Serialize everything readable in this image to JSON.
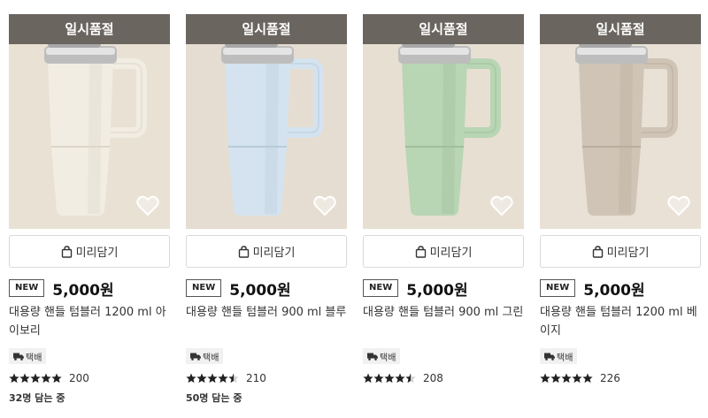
{
  "products": [
    {
      "soldout_label": "일시품절",
      "cart_label": "미리담기",
      "badge": "NEW",
      "price": "5,000원",
      "name": "대용량 핸들 텀블러 1200 ml 아이보리",
      "shipping": "택배",
      "rating": 5,
      "review_count": "200",
      "in_cart": "32명 담는 중",
      "bg_color": "#e9e1d4",
      "body_color": "#f1ede2",
      "shade_color": "#dcd6c9"
    },
    {
      "soldout_label": "일시품절",
      "cart_label": "미리담기",
      "badge": "NEW",
      "price": "5,000원",
      "name": "대용량 핸들 텀블러 900 ml 블루",
      "shipping": "택배",
      "rating": 4.5,
      "review_count": "210",
      "in_cart": "50명 담는 중",
      "bg_color": "#e5ddd1",
      "body_color": "#d4e3ef",
      "shade_color": "#b9cbd9"
    },
    {
      "soldout_label": "일시품절",
      "cart_label": "미리담기",
      "badge": "NEW",
      "price": "5,000원",
      "name": "대용량 핸들 텀블러 900 ml 그린",
      "shipping": "택배",
      "rating": 4.5,
      "review_count": "208",
      "in_cart": "",
      "bg_color": "#e7dfd2",
      "body_color": "#b8d5b4",
      "shade_color": "#9fbf9b"
    },
    {
      "soldout_label": "일시품절",
      "cart_label": "미리담기",
      "badge": "NEW",
      "price": "5,000원",
      "name": "대용량 핸들 텀블러 1200 ml 베이지",
      "shipping": "택배",
      "rating": 5,
      "review_count": "226",
      "in_cart": "",
      "bg_color": "#e9e1d5",
      "body_color": "#cfc4b6",
      "shade_color": "#b9ae9f"
    }
  ],
  "icons": {
    "heart": "heart-icon",
    "bag": "shopping-bag-icon",
    "truck": "truck-icon",
    "star": "star-icon"
  }
}
